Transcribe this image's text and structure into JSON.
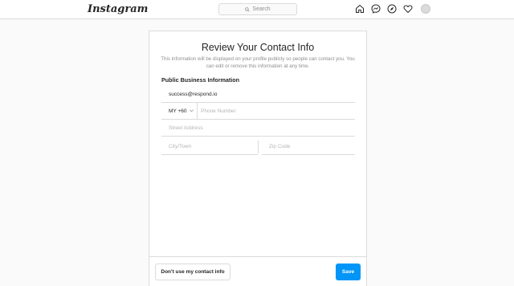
{
  "header": {
    "logo": "Instagram",
    "search_placeholder": "Search",
    "icons": [
      "home-icon",
      "messenger-icon",
      "explore-icon",
      "activity-heart-icon",
      "profile-avatar"
    ]
  },
  "dialog": {
    "title": "Review Your Contact Info",
    "description": "This information will be displayed on your profile publicly so people can contact you. You can edit or remove this information at any time.",
    "section_title": "Public Business Information",
    "email_value": "success@respond.io",
    "country_code": "MY +60",
    "phone_placeholder": "Phone Number",
    "street_placeholder": "Street Address",
    "city_placeholder": "City/Town",
    "zip_placeholder": "Zip Code",
    "secondary_button": "Don't use my contact info",
    "primary_button": "Save"
  },
  "colors": {
    "primary": "#0095f6",
    "border": "#dbdbdb",
    "background": "#fafafa",
    "muted_text": "#8e8e8e"
  }
}
